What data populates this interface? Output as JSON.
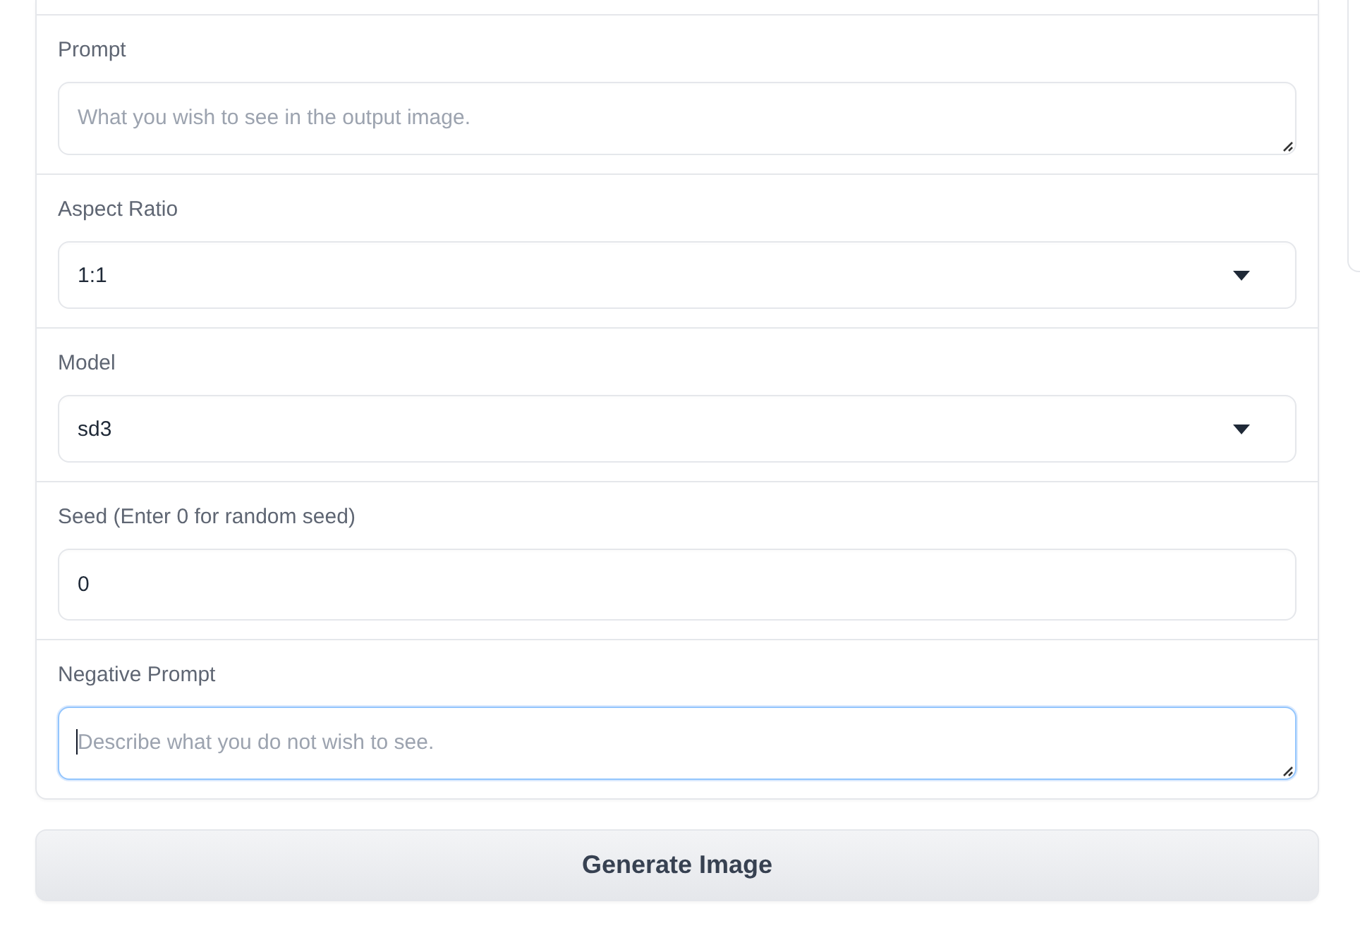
{
  "fields": [
    {
      "kind": "textarea",
      "label": "Prompt",
      "placeholder": "What you wish to see in the output image.",
      "focused": false
    },
    {
      "kind": "dropdown",
      "label": "Aspect Ratio",
      "value": "1:1",
      "focused": false
    },
    {
      "kind": "dropdown",
      "label": "Model",
      "value": "sd3",
      "focused": false
    },
    {
      "kind": "textbox",
      "label": "Seed (Enter 0 for random seed)",
      "value": "0",
      "focused": false
    },
    {
      "kind": "textarea",
      "label": "Negative Prompt",
      "placeholder": "Describe what you do not wish to see.",
      "focused": true
    }
  ],
  "button": {
    "label": "Generate Image"
  }
}
